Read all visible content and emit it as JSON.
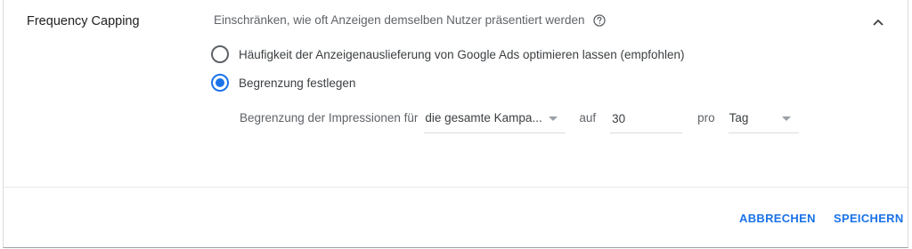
{
  "section": {
    "title": "Frequency Capping",
    "summary": "Einschränken, wie oft Anzeigen demselben Nutzer präsentiert werden",
    "help_icon": "help-circle-icon",
    "collapse_icon": "chevron-up-icon"
  },
  "options": [
    {
      "label": "Häufigkeit der Anzeigenauslieferung von Google Ads optimieren lassen (empfohlen)",
      "checked": false
    },
    {
      "label": "Begrenzung festlegen",
      "checked": true
    }
  ],
  "limit": {
    "label": "Begrenzung der Impressionen für",
    "scope_value": "die gesamte Kampa...",
    "word_on": "auf",
    "count_value": "30",
    "word_per": "pro",
    "period_value": "Tag"
  },
  "actions": {
    "cancel": "ABBRECHEN",
    "save": "SPEICHERN"
  },
  "colors": {
    "accent": "#1a73e8",
    "text": "#3c4043",
    "muted": "#5f6368"
  }
}
